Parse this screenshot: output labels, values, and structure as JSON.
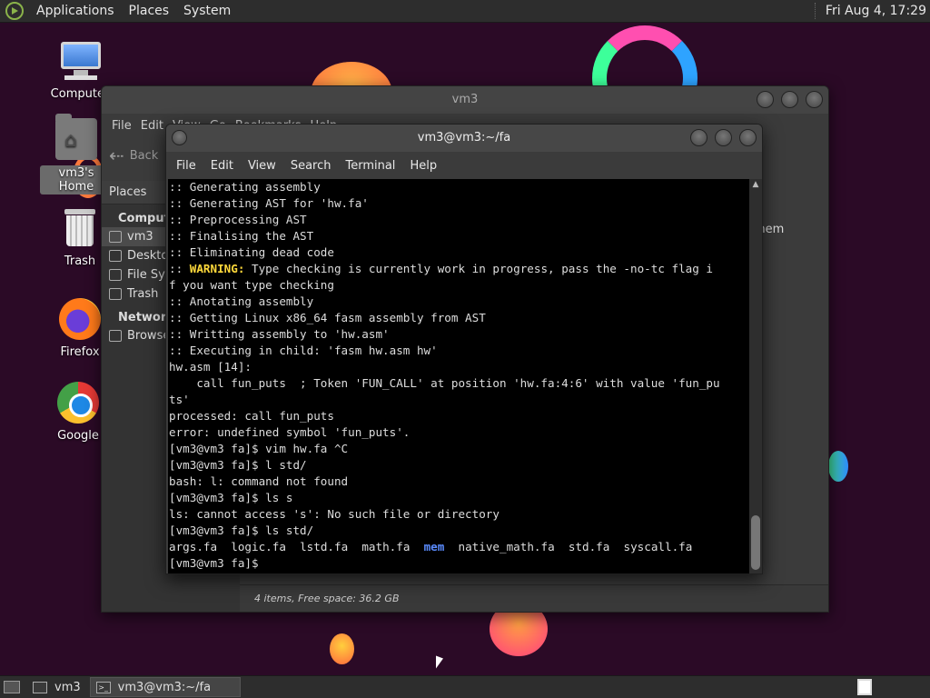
{
  "top_panel": {
    "menus": [
      "Applications",
      "Places",
      "System"
    ],
    "clock": "Fri Aug  4, 17:29"
  },
  "desktop_icons": [
    {
      "label": "Computer",
      "icon": "computer-icon"
    },
    {
      "label": "vm3's Home",
      "icon": "home-folder-icon"
    },
    {
      "label": "Trash",
      "icon": "trash-icon"
    },
    {
      "label": "Firefox",
      "icon": "firefox-icon"
    },
    {
      "label": "Google",
      "icon": "chrome-icon"
    }
  ],
  "file_manager": {
    "title": "vm3",
    "menus": [
      "File",
      "Edit",
      "View",
      "Go",
      "Bookmarks",
      "Help"
    ],
    "back_label": "Back",
    "places_label": "Places",
    "sections": [
      {
        "title": "Computer",
        "items": [
          "vm3",
          "Desktop",
          "File System",
          "Trash"
        ]
      },
      {
        "title": "Network",
        "items": [
          "Browse Network"
        ]
      }
    ],
    "file_peek": "mem",
    "status": "4 items, Free space: 36.2 GB"
  },
  "terminal": {
    "title": "vm3@vm3:~/fa",
    "menus": [
      "File",
      "Edit",
      "View",
      "Search",
      "Terminal",
      "Help"
    ],
    "lines": [
      ":: Generating assembly",
      ":: Generating AST for 'hw.fa'",
      ":: Preprocessing AST",
      ":: Finalising the AST",
      ":: Eliminating dead code",
      ":: WARNING: Type checking is currently work in progress, pass the -no-tc flag i",
      "f you want type checking",
      ":: Anotating assembly",
      ":: Getting Linux x86_64 fasm assembly from AST",
      ":: Writting assembly to 'hw.asm'",
      ":: Executing in child: 'fasm hw.asm hw'",
      "hw.asm [14]:",
      "    call fun_puts  ; Token 'FUN_CALL' at position 'hw.fa:4:6' with value 'fun_pu",
      "ts'",
      "processed: call fun_puts",
      "error: undefined symbol 'fun_puts'.",
      "[vm3@vm3 fa]$ vim hw.fa ^C",
      "[vm3@vm3 fa]$ l std/",
      "bash: l: command not found",
      "[vm3@vm3 fa]$ ls s",
      "ls: cannot access 's': No such file or directory",
      "[vm3@vm3 fa]$ ls std/"
    ],
    "warning_prefix": ":: ",
    "warning_word": "WARNING:",
    "warning_rest": " Type checking is currently work in progress, pass the -no-tc flag i",
    "ls_files": [
      "args.fa",
      "logic.fa",
      "lstd.fa",
      "math.fa"
    ],
    "ls_dir": "mem",
    "ls_files_after": [
      "native_math.fa",
      "std.fa",
      "syscall.fa"
    ],
    "prompt": "[vm3@vm3 fa]$ "
  },
  "bottom_panel": {
    "tasks": [
      {
        "label": "vm3",
        "active": false
      },
      {
        "label": "vm3@vm3:~/fa",
        "active": true
      }
    ]
  }
}
